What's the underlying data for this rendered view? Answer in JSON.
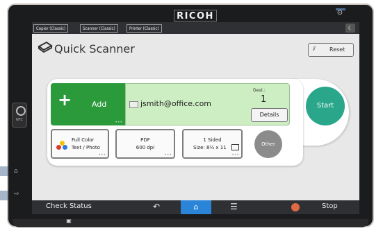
{
  "device": {
    "brand": "RICOH",
    "nfc_label": "NFC"
  },
  "topbar": {
    "tabs": [
      "Copier (Classic)",
      "Scanner (Classic)",
      "Printer (Classic)"
    ]
  },
  "header": {
    "title": "Quick Scanner",
    "reset_label": "Reset"
  },
  "destination": {
    "add_label": "Add",
    "email": "jsmith@office.com",
    "dest_label": "Dest.:",
    "dest_count": "1",
    "details_label": "Details"
  },
  "options": {
    "color": [
      "Full Color",
      "Text / Photo"
    ],
    "format": [
      "PDF",
      "600 dpi"
    ],
    "sides": [
      "1 Sided",
      "Size: 8½ x 11"
    ],
    "other_label": "Other"
  },
  "start_label": "Start",
  "bottombar": {
    "check_status": "Check Status",
    "stop": "Stop"
  },
  "colors": {
    "add_green": "#2a9a3a",
    "dest_bg": "#cdeec2",
    "start_teal": "#2aa68a",
    "home_blue": "#2a84d8",
    "stop_orange": "#e26a43"
  }
}
